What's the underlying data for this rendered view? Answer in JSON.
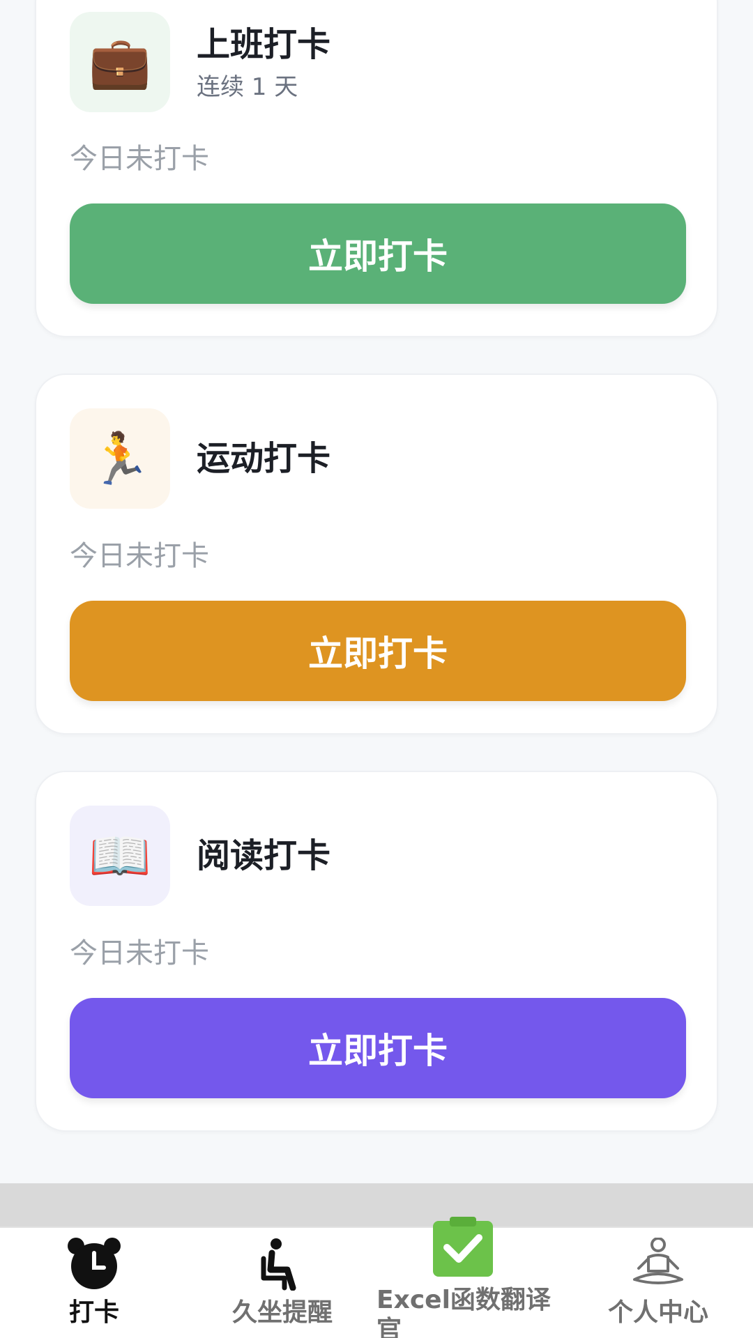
{
  "cards": [
    {
      "title": "上班打卡",
      "subtitle": "连续 1 天",
      "status": "今日未打卡",
      "button_label": "立即打卡",
      "icon": "briefcase-icon",
      "icon_glyph": "💼",
      "icon_bg": "#eef7f0",
      "button_color": "#5ab177"
    },
    {
      "title": "运动打卡",
      "subtitle": "",
      "status": "今日未打卡",
      "button_label": "立即打卡",
      "icon": "running-person-icon",
      "icon_glyph": "🏃",
      "icon_bg": "#fdf6ec",
      "button_color": "#de9421"
    },
    {
      "title": "阅读打卡",
      "subtitle": "",
      "status": "今日未打卡",
      "button_label": "立即打卡",
      "icon": "open-book-icon",
      "icon_glyph": "📖",
      "icon_bg": "#f1f0fc",
      "button_color": "#7458ec"
    }
  ],
  "tabbar": {
    "tabs": [
      {
        "label": "打卡",
        "icon": "alarm-clock-icon",
        "active": true
      },
      {
        "label": "久坐提醒",
        "icon": "seated-person-icon",
        "active": false
      },
      {
        "label": "Excel函数翻译官",
        "icon": "clipboard-check-icon",
        "active": false
      },
      {
        "label": "个人中心",
        "icon": "meditation-icon",
        "active": false
      }
    ]
  },
  "colors": {
    "active_tab": "#111111",
    "inactive_tab": "#707070",
    "excel_green": "#6cc24a"
  }
}
